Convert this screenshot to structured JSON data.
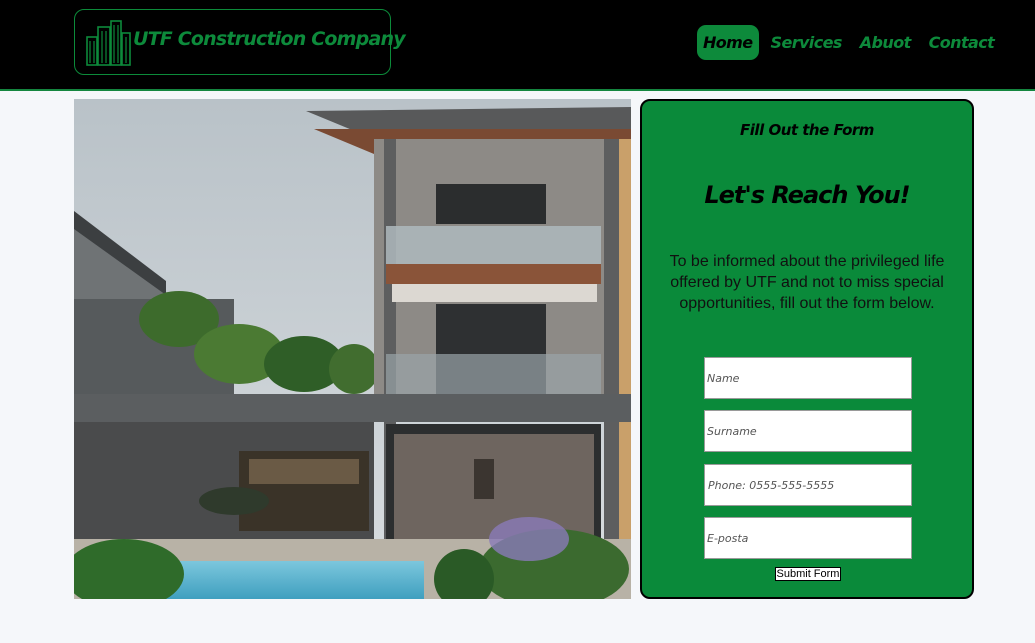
{
  "brand": {
    "name": "UTF Construction Company",
    "logo_icon": "city-buildings-icon"
  },
  "nav": {
    "items": [
      {
        "label": "Home",
        "active": true
      },
      {
        "label": "Services",
        "active": false
      },
      {
        "label": "Abuot",
        "active": false
      },
      {
        "label": "Contact",
        "active": false
      }
    ]
  },
  "hero": {
    "image": "modern-villa-with-pool-photo"
  },
  "form": {
    "kicker": "Fill Out the Form",
    "title": "Let's Reach You!",
    "description": "To be informed about the privileged life offered by UTF and not to miss special opportunities, fill out the form below.",
    "fields": {
      "name": {
        "placeholder": "Name",
        "value": ""
      },
      "surname": {
        "placeholder": "Surname",
        "value": ""
      },
      "phone": {
        "placeholder": "Phone: 0555-555-5555",
        "value": ""
      },
      "email": {
        "placeholder": "E-posta",
        "value": ""
      }
    },
    "submit_label": "Submit Form"
  },
  "colors": {
    "accent": "#0d8a3b",
    "header_bg": "#000000",
    "page_bg": "#f5f7fa"
  }
}
